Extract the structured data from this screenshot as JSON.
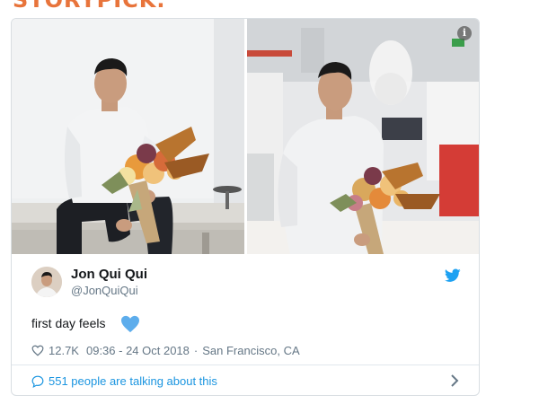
{
  "site": {
    "brand_text": "STORYPICK."
  },
  "tweet": {
    "author_name": "Jon Qui Qui",
    "author_handle": "@JonQuiQui",
    "text": "first day feels",
    "like_count": "12.7K",
    "timestamp": "09:36 - 24 Oct 2018",
    "separator": "·",
    "location": "San Francisco, CA",
    "talking_label": "551 people are talking about this"
  },
  "icons": {
    "info": "info-icon",
    "twitter": "twitter-bird-icon",
    "heart_emoji": "blue-heart-icon",
    "like": "heart-outline-icon",
    "conversation": "speech-bubble-icon",
    "chevron": "chevron-right-icon"
  },
  "colors": {
    "brand_orange": "#e8743b",
    "twitter_blue": "#1da1f2",
    "link_blue": "#1b95e0",
    "secondary_text": "#657786",
    "primary_text": "#14171a"
  }
}
